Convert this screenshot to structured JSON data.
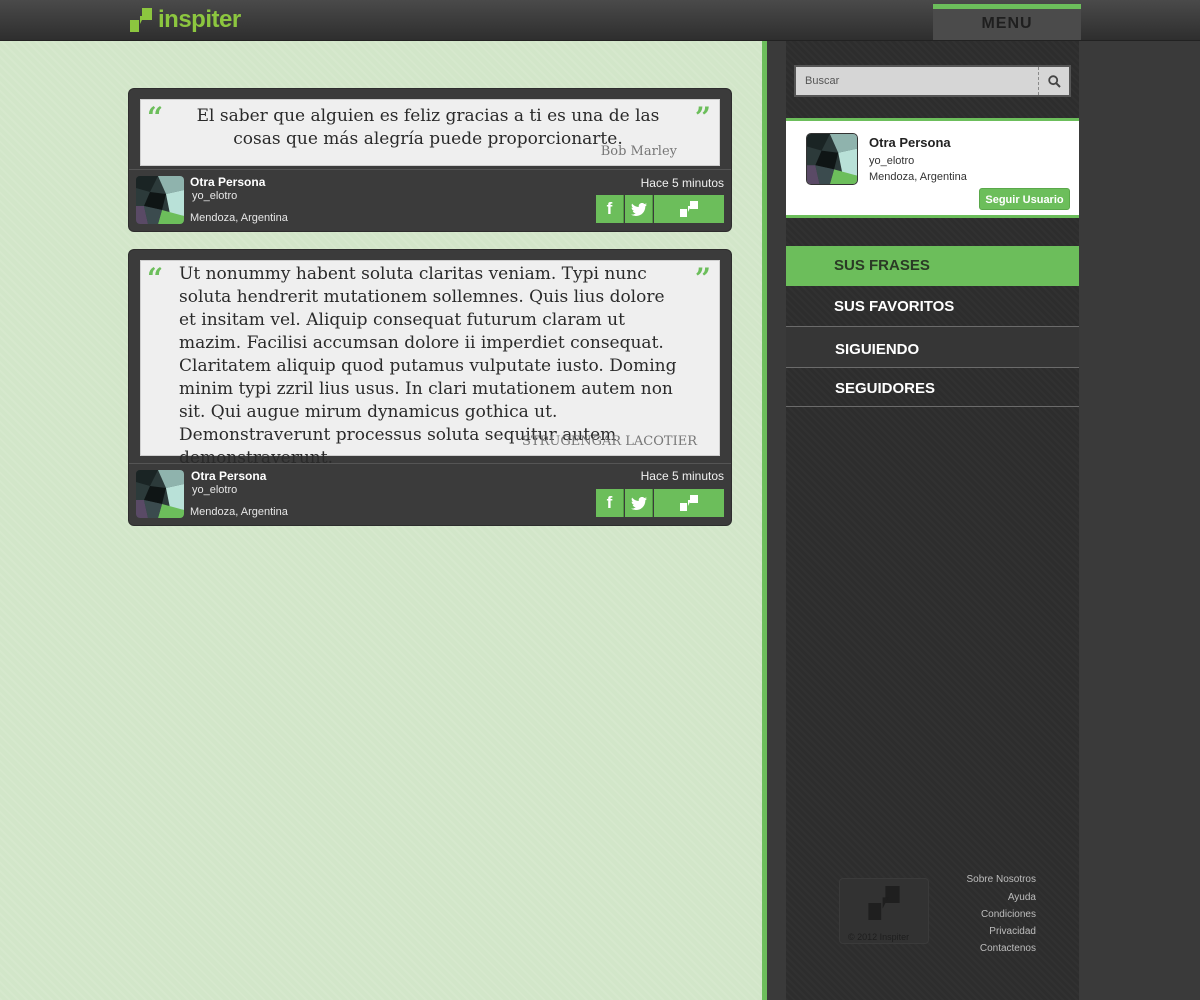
{
  "brand": {
    "name": "inspiter",
    "accent": "#6cbe5b",
    "logo_color": "#8cc63f"
  },
  "header": {
    "menu_label": "MENU"
  },
  "search": {
    "placeholder": "Buscar",
    "icon": "search-icon"
  },
  "quotes": [
    {
      "text": "El saber que alguien es feliz gracias a ti es una de las cosas que más alegría puede proporcionarte.",
      "author": "Bob Marley",
      "user": {
        "name": "Otra Persona",
        "handle": "yo_elotro",
        "location": "Mendoza, Argentina"
      },
      "time": "Hace 5 minutos",
      "share": {
        "facebook": "f",
        "twitter": "twitter-icon",
        "inspiter": "inspiter-icon"
      }
    },
    {
      "text": "Ut nonummy habent soluta claritas veniam. Typi nunc soluta hendrerit mutationem sollemnes. Quis lius dolore et insitam vel. Aliquip consequat futurum claram ut mazim. Facilisi accumsan dolore ii imperdiet consequat. Claritatem aliquip quod putamus vulputate iusto. Doming minim typi zzril lius usus. In clari mutationem autem non sit. Qui augue mirum dynamicus gothica ut. Demonstraverunt processus soluta sequitur autem demonstraverunt.",
      "author": "STRUGENGAR LACOTIER",
      "user": {
        "name": "Otra Persona",
        "handle": "yo_elotro",
        "location": "Mendoza, Argentina"
      },
      "time": "Hace 5 minutos",
      "share": {
        "facebook": "f",
        "twitter": "twitter-icon",
        "inspiter": "inspiter-icon"
      }
    }
  ],
  "profile": {
    "name": "Otra Persona",
    "handle": "yo_elotro",
    "location": "Mendoza, Argentina",
    "follow_label": "Seguir Usuario"
  },
  "nav": [
    {
      "label": "SUS FRASES",
      "active": true
    },
    {
      "label": "SUS FAVORITOS",
      "active": false
    },
    {
      "label": "SIGUIENDO",
      "active": false
    },
    {
      "label": "SEGUIDORES",
      "active": false
    }
  ],
  "footer": {
    "copyright": "© 2012 Inspiter",
    "links": [
      "Sobre Nosotros",
      "Ayuda",
      "Condiciones",
      "Privacidad",
      "Contactenos"
    ]
  }
}
